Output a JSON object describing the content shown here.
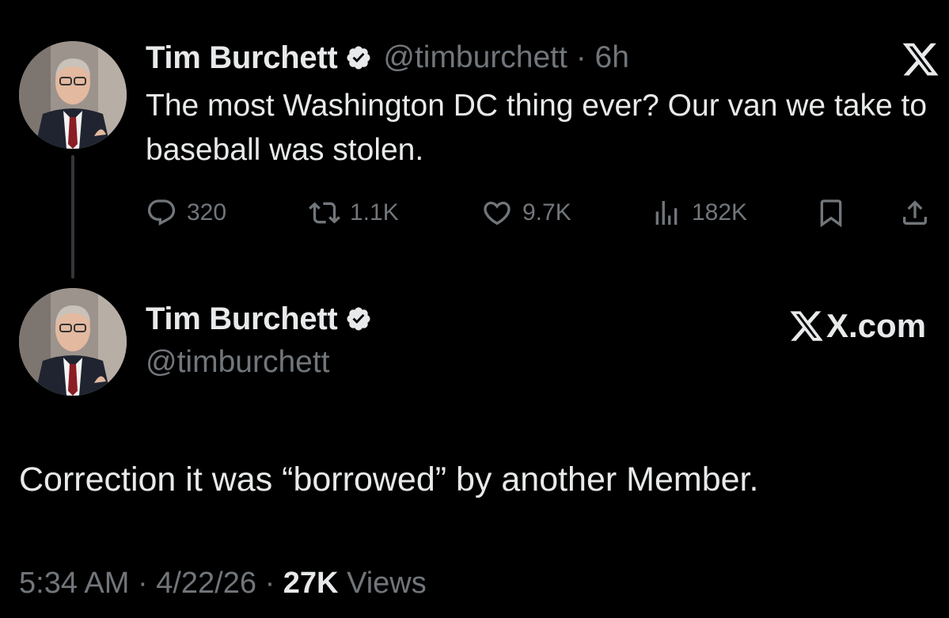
{
  "tweet_quoted": {
    "author_name": "Tim Burchett",
    "handle": "@timburchett",
    "separator": "·",
    "time_ago": "6h",
    "text": "The most Washington DC thing ever? Our van we take to baseball was stolen.",
    "stats": {
      "replies": "320",
      "retweets": "1.1K",
      "likes": "9.7K",
      "views": "182K"
    },
    "platform_logo": "X"
  },
  "tweet_main": {
    "author_name": "Tim Burchett",
    "handle": "@timburchett",
    "platform_label": "X.com",
    "text": "Correction it was “borrowed” by another Member.",
    "footer": {
      "time": "5:34 AM",
      "sep1": "·",
      "date": "4/22/26",
      "sep2": "·",
      "views_count": "27K",
      "views_label": "Views"
    }
  },
  "colors": {
    "background": "#000000",
    "primary_text": "#e7e9ea",
    "secondary_text": "#71767b",
    "verified_badge": "#e7e9ea"
  },
  "icons": [
    "reply-icon",
    "retweet-icon",
    "like-icon",
    "views-icon",
    "bookmark-icon",
    "share-icon",
    "verified-badge-icon",
    "x-logo-icon"
  ]
}
